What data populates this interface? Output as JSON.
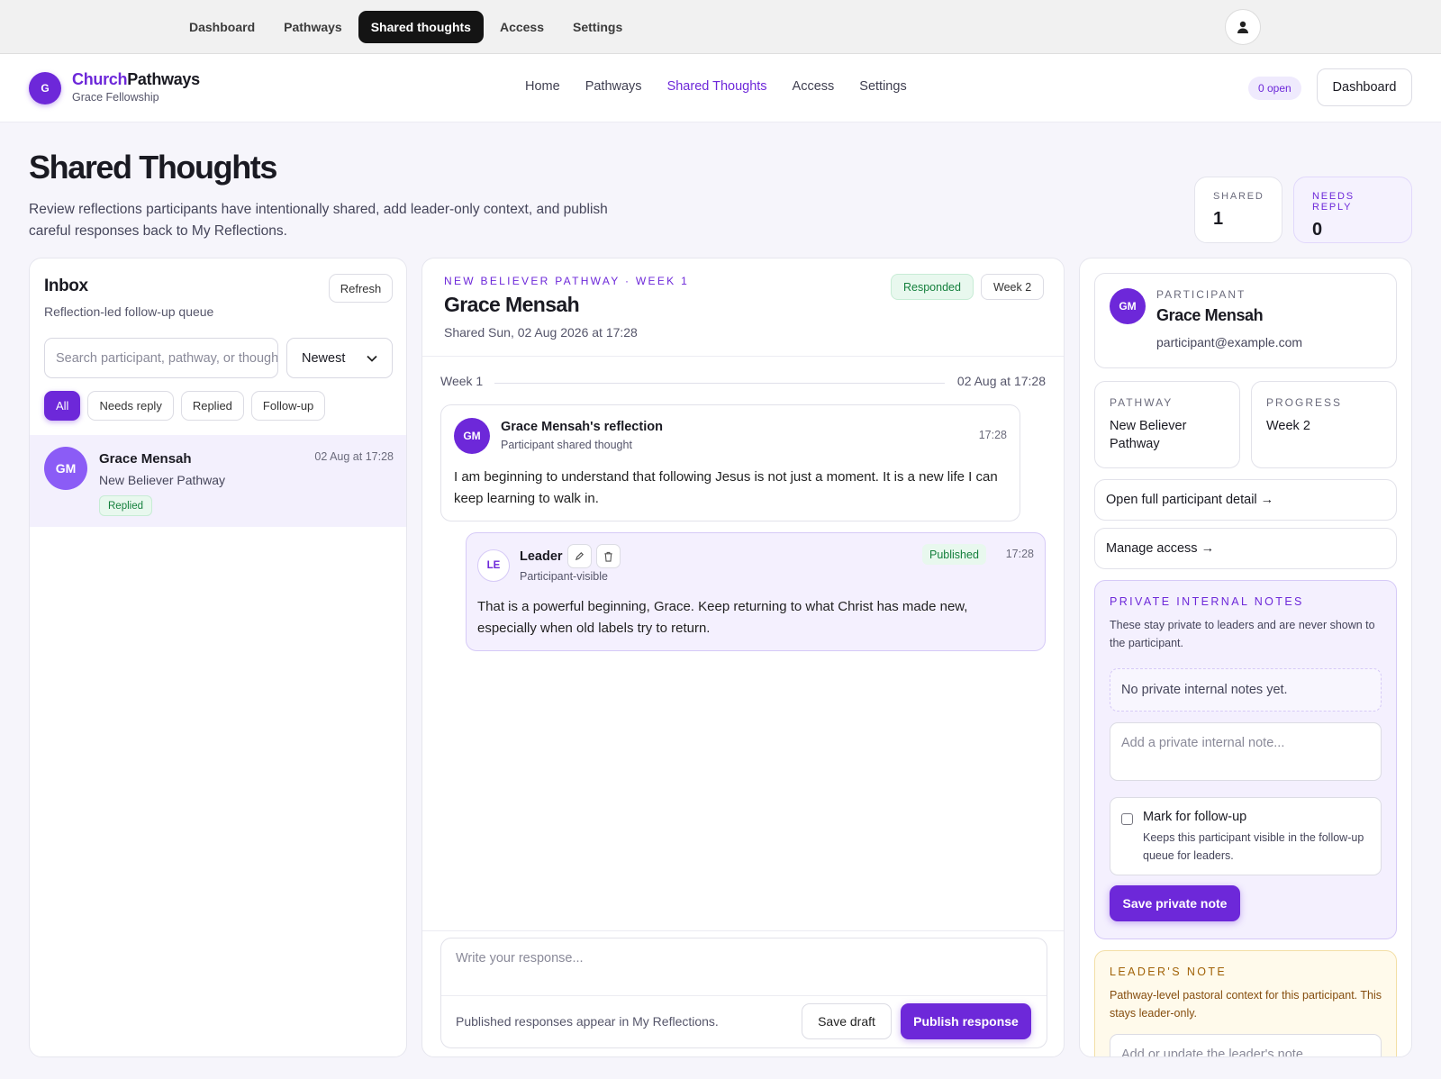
{
  "topnav": {
    "items": [
      "Dashboard",
      "Pathways",
      "Shared thoughts",
      "Access",
      "Settings"
    ],
    "active": "Shared thoughts",
    "avatar_icon": "user-icon"
  },
  "header": {
    "badge": "G",
    "brand_part1": "Church",
    "brand_part2": "Pathways",
    "org": "Grace Fellowship",
    "nav": [
      "Home",
      "Pathways",
      "Shared Thoughts",
      "Access",
      "Settings"
    ],
    "open_count": "0 open",
    "dashboard_label": "Dashboard"
  },
  "page": {
    "title": "Shared Thoughts",
    "description": "Review reflections participants have intentionally shared, add leader-only context, and publish careful responses back to My Reflections.",
    "stats": [
      {
        "label": "SHARED",
        "value": "1"
      },
      {
        "label": "NEEDS REPLY",
        "value": "0"
      }
    ]
  },
  "inbox": {
    "title": "Inbox",
    "subtitle": "Reflection-led follow-up queue",
    "refresh_label": "Refresh",
    "search_placeholder": "Search participant, pathway, or thought",
    "sort_value": "Newest",
    "filters": [
      "All",
      "Needs reply",
      "Replied",
      "Follow-up"
    ],
    "active_filter": "All",
    "items": [
      {
        "initials": "GM",
        "name": "Grace Mensah",
        "pathway": "New Believer Pathway",
        "time": "02 Aug at 17:28",
        "status": "Replied"
      }
    ]
  },
  "thread": {
    "eyebrow": "NEW BELIEVER PATHWAY · WEEK 1",
    "name": "Grace Mensah",
    "shared": "Shared Sun, 02 Aug 2026 at 17:28",
    "status": "Responded",
    "week": "Week 2",
    "week_label": "Week 1",
    "week_date": "02 Aug at 17:28",
    "reflection": {
      "initials": "GM",
      "title": "Grace Mensah's reflection",
      "subtitle": "Participant shared thought",
      "time": "17:28",
      "body": "I am beginning to understand that following Jesus is not just a moment. It is a new life I can keep learning to walk in."
    },
    "response": {
      "initials": "LE",
      "author": "Leader",
      "visibility": "Participant-visible",
      "status": "Published",
      "time": "17:28",
      "edit_icon": "pencil-icon",
      "delete_icon": "trash-icon",
      "body": "That is a powerful beginning, Grace. Keep returning to what Christ has made new, especially when old labels try to return."
    },
    "composer": {
      "placeholder": "Write your response...",
      "hint": "Published responses appear in My Reflections.",
      "save_draft": "Save draft",
      "publish": "Publish response"
    }
  },
  "participant": {
    "label": "PARTICIPANT",
    "initials": "GM",
    "name": "Grace Mensah",
    "email": "participant@example.com",
    "pathway_label": "PATHWAY",
    "pathway": "New Believer Pathway",
    "progress_label": "PROGRESS",
    "progress": "Week 2",
    "detail_link": "Open full participant detail →",
    "access_link": "Manage access →"
  },
  "private_notes": {
    "label": "PRIVATE INTERNAL NOTES",
    "description": "These stay private to leaders and are never shown to the participant.",
    "empty": "No private internal notes yet.",
    "placeholder": "Add a private internal note...",
    "followup_title": "Mark for follow-up",
    "followup_desc": "Keeps this participant visible in the follow-up queue for leaders.",
    "save": "Save private note"
  },
  "leader_note": {
    "label": "LEADER'S NOTE",
    "description": "Pathway-level pastoral context for this participant. This stays leader-only.",
    "placeholder": "Add or update the leader's note..."
  },
  "colors": {
    "accent": "#6d28d9",
    "success": "#15803d",
    "warning": "#a16207"
  }
}
